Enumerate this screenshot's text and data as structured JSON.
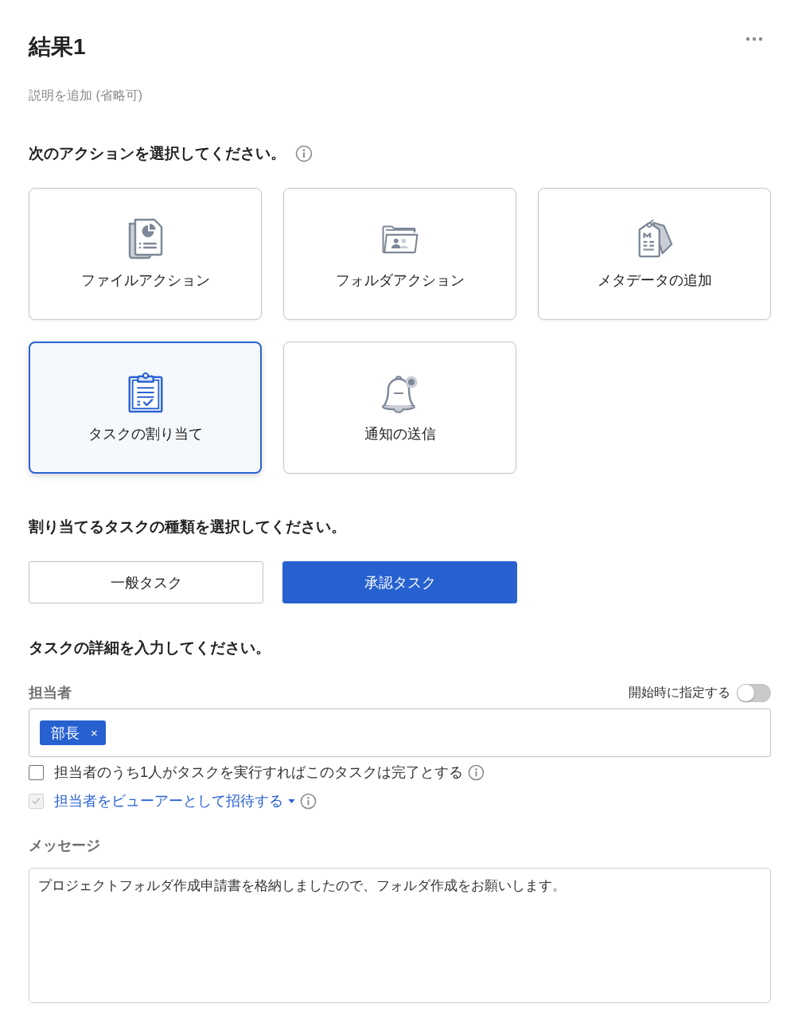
{
  "header": {
    "title": "結果1",
    "description": {
      "placeholder": "説明を追加 (省略可)"
    }
  },
  "actions": {
    "heading": "次のアクションを選択してください。",
    "options": [
      {
        "label": "ファイルアクション",
        "kind": "file",
        "selected": false
      },
      {
        "label": "フォルダアクション",
        "kind": "folder",
        "selected": false
      },
      {
        "label": "メタデータの追加",
        "kind": "metadata",
        "selected": false
      },
      {
        "label": "タスクの割り当て",
        "kind": "task",
        "selected": true
      },
      {
        "label": "通知の送信",
        "kind": "notify",
        "selected": false
      }
    ]
  },
  "task_type": {
    "heading": "割り当てるタスクの種類を選択してください。",
    "options": [
      {
        "label": "一般タスク",
        "selected": false
      },
      {
        "label": "承認タスク",
        "selected": true
      }
    ]
  },
  "details": {
    "heading": "タスクの詳細を入力してください。",
    "assignee": {
      "label": "担当者",
      "toggle": {
        "label": "開始時に指定する",
        "on": false
      },
      "chips": [
        {
          "label": "部長",
          "remove": "×"
        }
      ]
    },
    "options": [
      {
        "kind": "plain",
        "label": "担当者のうち1人がタスクを実行すればこのタスクは完了とする",
        "checked": false,
        "disabled": false
      },
      {
        "kind": "dropdown-link",
        "label": "担当者をビューアーとして招待する",
        "checked": true,
        "disabled": true
      }
    ],
    "message": {
      "label": "メッセージ",
      "value": "プロジェクトフォルダ作成申請書を格納しましたので、フォルダ作成をお願いします。"
    }
  }
}
